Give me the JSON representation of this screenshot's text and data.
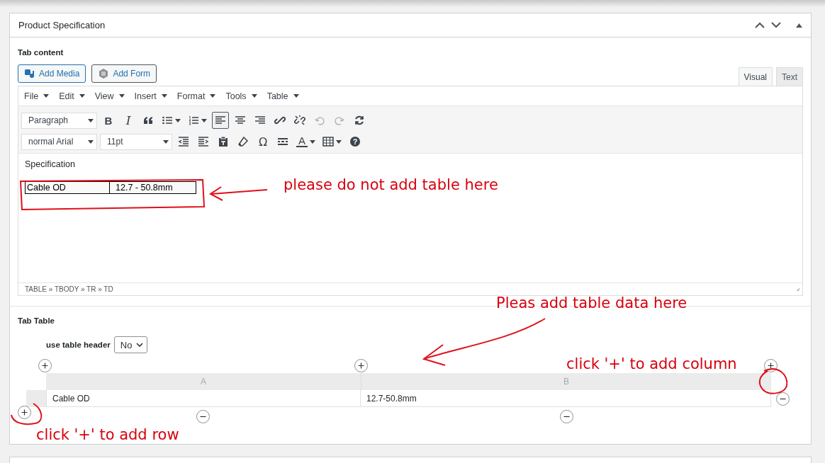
{
  "panel": {
    "title": "Product Specification"
  },
  "tab_content": {
    "label": "Tab content",
    "media_buttons": [
      "Add Media",
      "Add Form"
    ],
    "editor_tabs": [
      {
        "label": "Visual",
        "selected": true
      },
      {
        "label": "Text",
        "selected": false
      }
    ],
    "menubar": [
      "File",
      "Edit",
      "View",
      "Insert",
      "Format",
      "Tools",
      "Table"
    ],
    "toolbar_rows": [
      [
        {
          "kind": "select",
          "value": "Paragraph"
        },
        {
          "kind": "bold",
          "text": "B"
        },
        {
          "kind": "italic",
          "text": "I"
        },
        {
          "kind": "icon",
          "pressed": false,
          "disabled": false
        },
        {
          "kind": "icon",
          "caret": true,
          "pressed": false,
          "disabled": false
        },
        {
          "kind": "icon",
          "caret": true,
          "pressed": false,
          "disabled": false
        },
        {
          "kind": "icon",
          "pressed": true,
          "disabled": false
        },
        {
          "kind": "icon",
          "pressed": false,
          "disabled": false
        },
        {
          "kind": "icon",
          "pressed": false,
          "disabled": false
        },
        {
          "kind": "icon",
          "pressed": false,
          "disabled": false
        },
        {
          "kind": "icon",
          "pressed": false,
          "disabled": false
        },
        {
          "kind": "icon",
          "pressed": false,
          "disabled": true
        },
        {
          "kind": "icon",
          "pressed": false,
          "disabled": true
        },
        {
          "kind": "icon",
          "pressed": false,
          "disabled": false
        }
      ],
      [
        {
          "kind": "select",
          "value": "normal Arial"
        },
        {
          "kind": "select",
          "value": "11pt"
        },
        {
          "kind": "icon",
          "pressed": false,
          "disabled": false
        },
        {
          "kind": "icon",
          "pressed": false,
          "disabled": false
        },
        {
          "kind": "icon",
          "pressed": false,
          "disabled": false
        },
        {
          "kind": "icon",
          "pressed": false,
          "disabled": false
        },
        {
          "kind": "symbol",
          "text": "Ω"
        },
        {
          "kind": "icon",
          "pressed": false,
          "disabled": false
        },
        {
          "kind": "textcolor",
          "text": "A",
          "caret": true
        },
        {
          "kind": "icon",
          "caret": true,
          "pressed": false,
          "disabled": false
        },
        {
          "kind": "help",
          "text": "?"
        }
      ]
    ],
    "content": {
      "paragraph": "Specification",
      "table": [
        [
          "Cable OD",
          "12.7 - 50.8mm"
        ]
      ]
    },
    "status_path": "TABLE » TBODY » TR » TD"
  },
  "tab_table": {
    "label": "Tab Table",
    "header_option": {
      "label": "use table header",
      "value": "No"
    },
    "columns": [
      "A",
      "B"
    ],
    "rows": [
      [
        "Cable OD",
        "12.7-50.8mm"
      ]
    ]
  },
  "annotations": [
    {
      "text": "please do not add table here"
    },
    {
      "text": "Pleas add table data here"
    },
    {
      "text": "click '+' to add column"
    },
    {
      "text": "click '+' to add row"
    }
  ]
}
